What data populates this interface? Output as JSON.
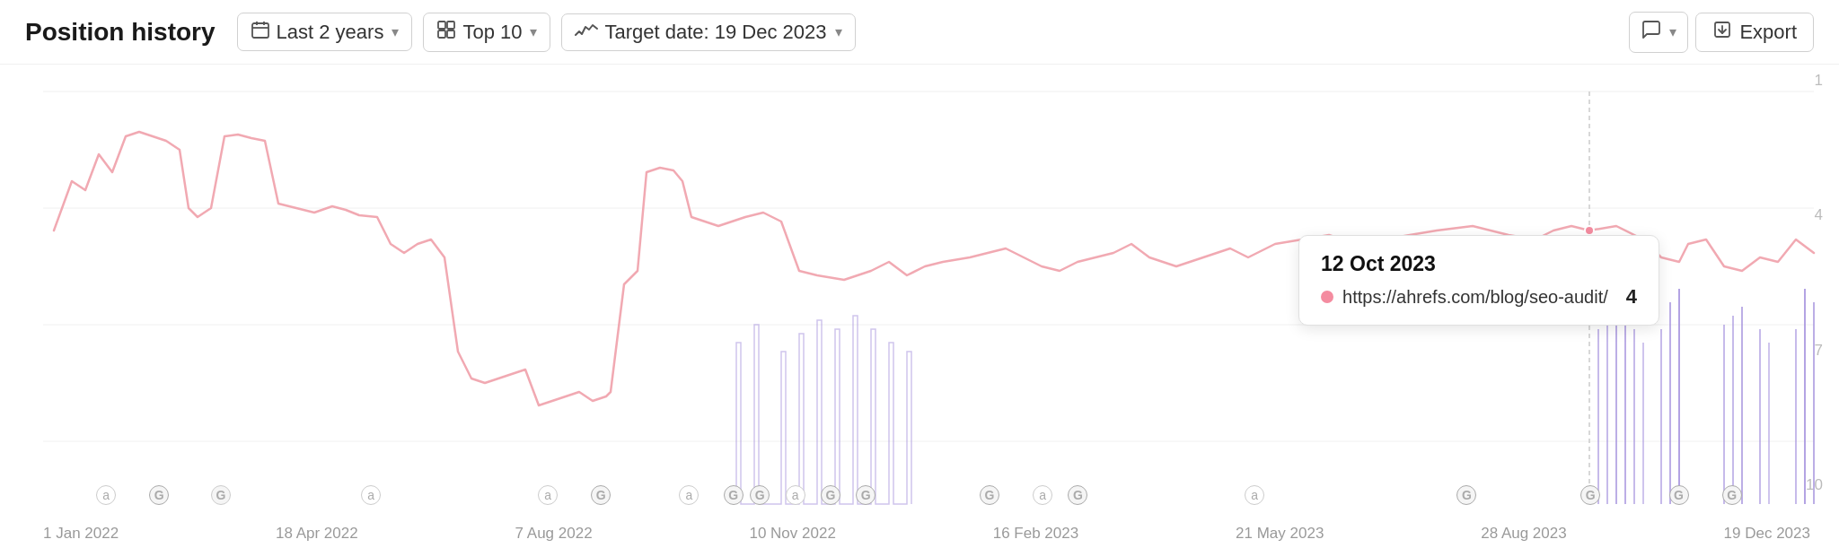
{
  "header": {
    "title": "Position history",
    "date_range_label": "Last 2 years",
    "top_label": "Top 10",
    "target_label": "Target date: 19 Dec 2023",
    "export_label": "Export"
  },
  "chart": {
    "x_labels": [
      "1 Jan 2022",
      "18 Apr 2022",
      "7 Aug 2022",
      "10 Nov 2022",
      "16 Feb 2023",
      "21 May 2023",
      "28 Aug 2023",
      "19 Dec 2023"
    ],
    "y_labels": [
      "1",
      "4",
      "7",
      "10"
    ],
    "tooltip": {
      "date": "12 Oct 2023",
      "url": "https://ahrefs.com/blog/seo-audit/",
      "value": "4"
    }
  },
  "icons": {
    "calendar": "📅",
    "grid": "⊞",
    "trend": "∿",
    "chevron_down": "▾",
    "comment": "💬",
    "export_icon": "⬇"
  }
}
